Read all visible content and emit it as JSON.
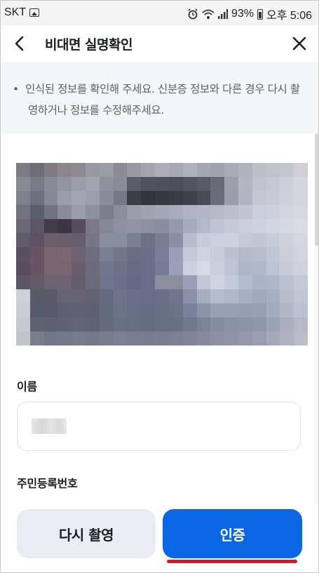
{
  "status_bar": {
    "carrier": "SKT",
    "battery": "93%",
    "time": "오후 5:06"
  },
  "header": {
    "title": "비대면 실명확인"
  },
  "notice": {
    "bullet": "•",
    "text": "인식된 정보를 확인해 주세요. 신분증 정보와 다른 경우 다시 촬영하거나 정보를 수정해주세요."
  },
  "form": {
    "name_label": "이름",
    "rrn_label": "주민등록번호"
  },
  "buttons": {
    "retake": "다시 촬영",
    "verify": "인증"
  },
  "colors": {
    "primary": "#0a66e3",
    "secondary_button": "#e9ecf3",
    "notice_bg": "#f4f5f7",
    "highlight": "#e0112b"
  },
  "icons": {
    "back": "chevron-left-icon",
    "close": "close-icon"
  }
}
